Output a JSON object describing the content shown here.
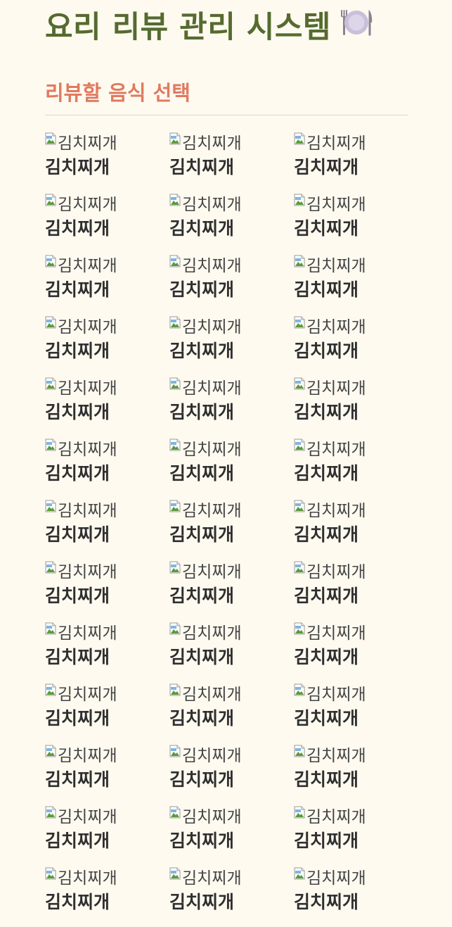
{
  "header": {
    "title": "요리 리뷰 관리 시스템",
    "title_icon": "plate-with-cutlery-icon",
    "title_color": "#556b2f"
  },
  "selection": {
    "heading": "리뷰할 음식 선택",
    "heading_color": "#e07a5f"
  },
  "food_items": [
    {
      "name": "김치찌개",
      "image_alt": "김치찌개"
    },
    {
      "name": "김치찌개",
      "image_alt": "김치찌개"
    },
    {
      "name": "김치찌개",
      "image_alt": "김치찌개"
    },
    {
      "name": "김치찌개",
      "image_alt": "김치찌개"
    },
    {
      "name": "김치찌개",
      "image_alt": "김치찌개"
    },
    {
      "name": "김치찌개",
      "image_alt": "김치찌개"
    },
    {
      "name": "김치찌개",
      "image_alt": "김치찌개"
    },
    {
      "name": "김치찌개",
      "image_alt": "김치찌개"
    },
    {
      "name": "김치찌개",
      "image_alt": "김치찌개"
    },
    {
      "name": "김치찌개",
      "image_alt": "김치찌개"
    },
    {
      "name": "김치찌개",
      "image_alt": "김치찌개"
    },
    {
      "name": "김치찌개",
      "image_alt": "김치찌개"
    },
    {
      "name": "김치찌개",
      "image_alt": "김치찌개"
    },
    {
      "name": "김치찌개",
      "image_alt": "김치찌개"
    },
    {
      "name": "김치찌개",
      "image_alt": "김치찌개"
    },
    {
      "name": "김치찌개",
      "image_alt": "김치찌개"
    },
    {
      "name": "김치찌개",
      "image_alt": "김치찌개"
    },
    {
      "name": "김치찌개",
      "image_alt": "김치찌개"
    },
    {
      "name": "김치찌개",
      "image_alt": "김치찌개"
    },
    {
      "name": "김치찌개",
      "image_alt": "김치찌개"
    },
    {
      "name": "김치찌개",
      "image_alt": "김치찌개"
    },
    {
      "name": "김치찌개",
      "image_alt": "김치찌개"
    },
    {
      "name": "김치찌개",
      "image_alt": "김치찌개"
    },
    {
      "name": "김치찌개",
      "image_alt": "김치찌개"
    },
    {
      "name": "김치찌개",
      "image_alt": "김치찌개"
    },
    {
      "name": "김치찌개",
      "image_alt": "김치찌개"
    },
    {
      "name": "김치찌개",
      "image_alt": "김치찌개"
    },
    {
      "name": "김치찌개",
      "image_alt": "김치찌개"
    },
    {
      "name": "김치찌개",
      "image_alt": "김치찌개"
    },
    {
      "name": "김치찌개",
      "image_alt": "김치찌개"
    },
    {
      "name": "김치찌개",
      "image_alt": "김치찌개"
    },
    {
      "name": "김치찌개",
      "image_alt": "김치찌개"
    },
    {
      "name": "김치찌개",
      "image_alt": "김치찌개"
    },
    {
      "name": "김치찌개",
      "image_alt": "김치찌개"
    },
    {
      "name": "김치찌개",
      "image_alt": "김치찌개"
    },
    {
      "name": "김치찌개",
      "image_alt": "김치찌개"
    },
    {
      "name": "김치찌개",
      "image_alt": "김치찌개"
    },
    {
      "name": "김치찌개",
      "image_alt": "김치찌개"
    },
    {
      "name": "김치찌개",
      "image_alt": "김치찌개"
    }
  ]
}
